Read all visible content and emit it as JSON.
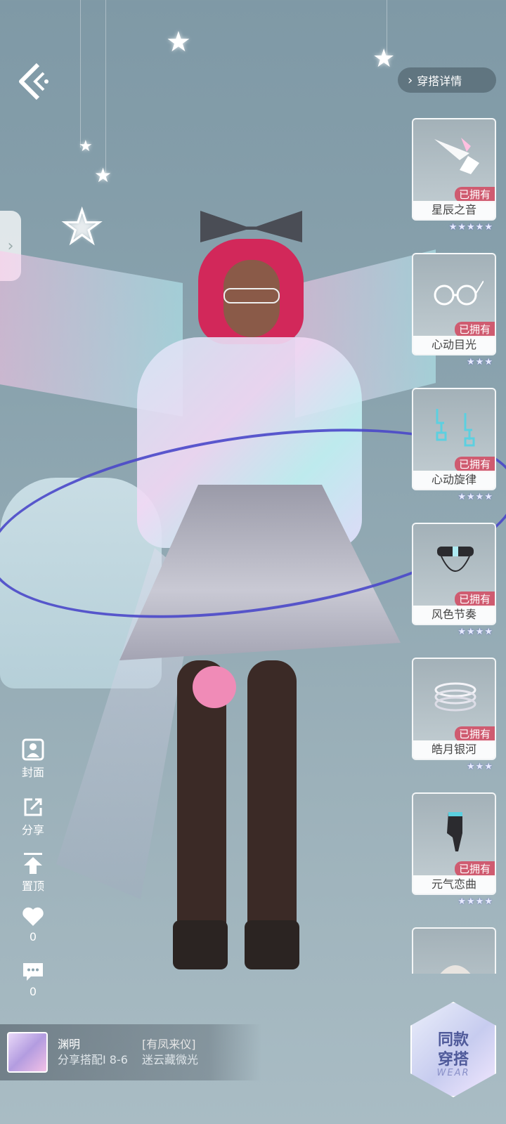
{
  "header": {
    "back_icon": "chevron-left-icon",
    "detail_button_label": "穿搭详情"
  },
  "items": [
    {
      "name": "星辰之音",
      "owned_label": "已拥有",
      "stars": "★★★★★",
      "icon": "music-note-icon"
    },
    {
      "name": "心动目光",
      "owned_label": "已拥有",
      "stars": "★★★",
      "icon": "glasses-icon"
    },
    {
      "name": "心动旋律",
      "owned_label": "已拥有",
      "stars": "★★★★",
      "icon": "earring-icon"
    },
    {
      "name": "风色节奏",
      "owned_label": "已拥有",
      "stars": "★★★★",
      "icon": "choker-icon"
    },
    {
      "name": "皓月银河",
      "owned_label": "已拥有",
      "stars": "★★★",
      "icon": "bracelet-icon"
    },
    {
      "name": "元气恋曲",
      "owned_label": "已拥有",
      "stars": "★★★★",
      "icon": "glove-icon"
    }
  ],
  "actions": {
    "cover_label": "封面",
    "share_label": "分享",
    "pin_label": "置顶",
    "like_count": "0",
    "comment_count": "0"
  },
  "user": {
    "name": "渊明",
    "tag": "[有凤来仪]",
    "share_info": "分享搭配I 8-6",
    "outfit_name": "迷云藏微光"
  },
  "same_outfit": {
    "line1": "同款",
    "line2": "穿搭",
    "wear": "WEAR"
  },
  "colors": {
    "owned_badge": "#cf5b70",
    "orbit": "#4a48c9",
    "hair": "#d2285a"
  }
}
